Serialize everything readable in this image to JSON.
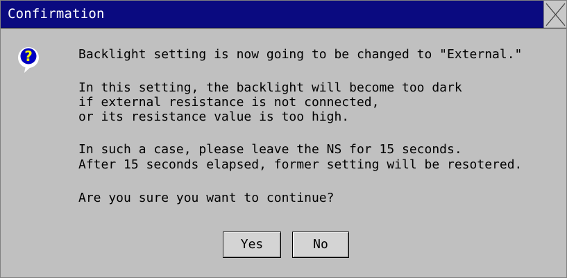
{
  "window": {
    "title": "Confirmation",
    "close_icon": "close-x-icon"
  },
  "icon": {
    "name": "question-icon",
    "glyph": "?"
  },
  "message": {
    "line1": "Backlight setting is now going to be changed to \"External.\"",
    "para2_line1": "In this setting, the backlight will become too dark",
    "para2_line2": "if external resistance is not connected,",
    "para2_line3": "or its resistance value is too high.",
    "para3_line1": "In such a case, please leave the NS for 15 seconds.",
    "para3_line2": "After 15 seconds elapsed, former setting will be resotered.",
    "question": "Are you sure you want to continue?"
  },
  "buttons": {
    "yes_label": "Yes",
    "no_label": "No"
  },
  "colors": {
    "titlebar": "#0a0a80",
    "background": "#c0c0c0",
    "icon_fill": "#0000c0"
  }
}
